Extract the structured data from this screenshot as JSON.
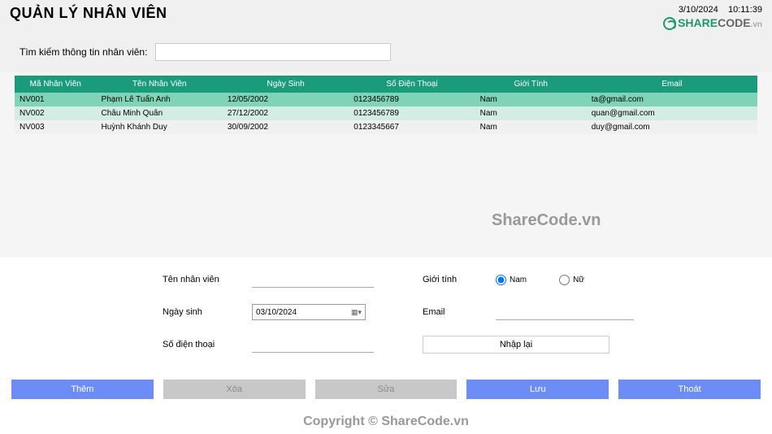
{
  "header": {
    "title": "QUẢN LÝ NHÂN VIÊN",
    "date": "3/10/2024",
    "time": "10:11:39",
    "logo_share": "SHARE",
    "logo_code": "CODE",
    "logo_vn": ".vn"
  },
  "search": {
    "label": "Tìm kiếm thông tin nhân viên:",
    "value": ""
  },
  "table": {
    "headers": {
      "id": "Mã Nhân Viên",
      "name": "Tên Nhân Viên",
      "dob": "Ngày Sinh",
      "phone": "Số Điện Thoại",
      "gender": "Giới Tính",
      "email": "Email"
    },
    "rows": [
      {
        "id": "NV001",
        "name": "Phạm Lê Tuấn Anh",
        "dob": "12/05/2002",
        "phone": "0123456789",
        "gender": "Nam",
        "email": "ta@gmail.com"
      },
      {
        "id": "NV002",
        "name": "Châu Minh Quân",
        "dob": "27/12/2002",
        "phone": "0123456789",
        "gender": "Nam",
        "email": "quan@gmail.com"
      },
      {
        "id": "NV003",
        "name": "Huỳnh Khánh Duy",
        "dob": "30/09/2002",
        "phone": "0123345667",
        "gender": "Nam",
        "email": "duy@gmail.com"
      }
    ]
  },
  "form": {
    "name_label": "Tên nhân viên",
    "name_value": "",
    "dob_label": "Ngày sinh",
    "dob_value": "03/10/2024",
    "phone_label": "Số điện thoại",
    "phone_value": "",
    "gender_label": "Giới tính",
    "gender_options": {
      "male": "Nam",
      "female": "Nữ"
    },
    "email_label": "Email",
    "email_value": "",
    "reset_label": "Nhập lại"
  },
  "buttons": {
    "add": "Thêm",
    "delete": "Xóa",
    "edit": "Sửa",
    "save": "Lưu",
    "exit": "Thoát"
  },
  "watermarks": {
    "wm1": "ShareCode.vn",
    "wm2": "ShareCode.vn",
    "footer": "Copyright © ShareCode.vn"
  }
}
